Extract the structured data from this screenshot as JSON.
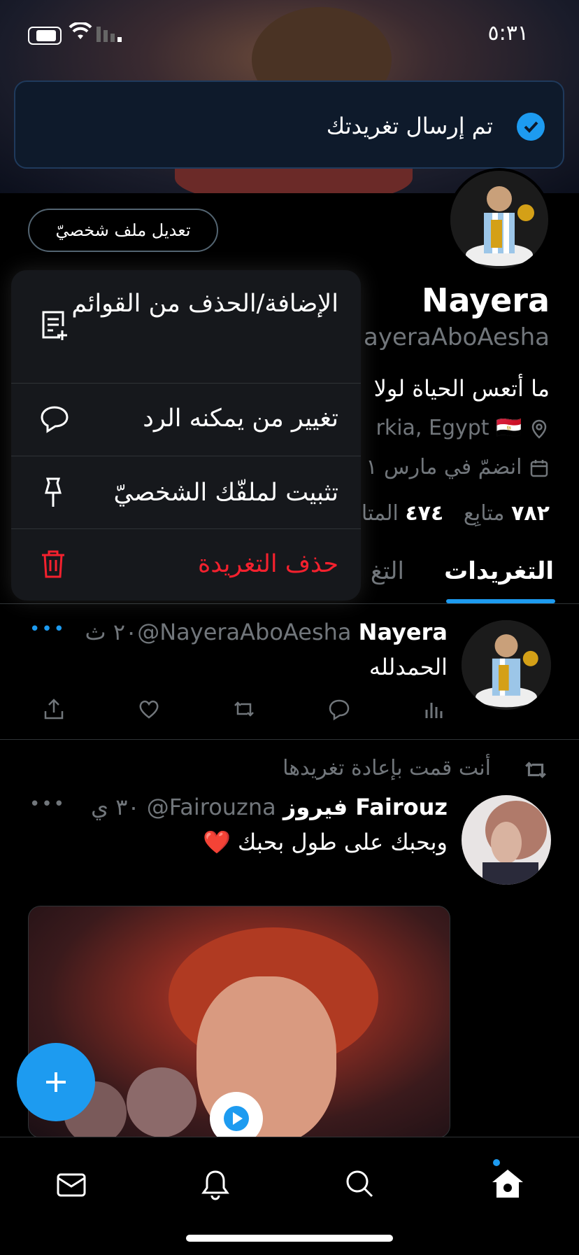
{
  "status_bar": {
    "time": "٥:٣١"
  },
  "toast": {
    "message": "تم إرسال تغريدتك",
    "icon": "check-circle-icon"
  },
  "profile": {
    "edit_button": "تعديل ملف شخصيّ",
    "name": "Nayera",
    "handle": "ayeraAboAesha",
    "bio": "ما أتعس الحياة لولا",
    "location": "rkia, Egypt 🇪🇬",
    "joined": "انضمّ في مارس ١",
    "following_count": "٧٨٢",
    "following_label": "متابِع",
    "followers_count": "٤٧٤",
    "followers_label": "المتا"
  },
  "tabs": [
    {
      "label": "التغريدات",
      "active": true
    },
    {
      "label": "التغ",
      "active": false
    }
  ],
  "menu": {
    "items": [
      {
        "label": "الإضافة/الحذف من القوائم",
        "icon": "list-add-icon"
      },
      {
        "label": "تغيير من يمكنه الرد",
        "icon": "speech-bubble-icon"
      },
      {
        "label": "تثبيت لملفّك الشخصيّ",
        "icon": "pin-icon"
      },
      {
        "label": "حذف التغريدة",
        "icon": "trash-icon",
        "destructive": true
      }
    ]
  },
  "tweets": [
    {
      "name": "Nayera",
      "handle": "@NayeraAboAesha",
      "time": "٢٠ ث",
      "text": "الحمدلله",
      "more": "•••"
    },
    {
      "retweet_label": "أنت قمت بإعادة تغريدها",
      "name": "فيروز Fairouz",
      "handle": "@Fairouzna",
      "time": "٣٠ ي",
      "text": "وبحبك على طول بحبك ❤️",
      "more": "•••"
    }
  ],
  "colors": {
    "accent": "#1d9bf0",
    "danger": "#f4212e",
    "background": "#000000",
    "muted": "#71767b"
  },
  "bottom_nav": [
    {
      "name": "home",
      "icon": "home-icon",
      "active": true
    },
    {
      "name": "search",
      "icon": "search-icon"
    },
    {
      "name": "notifications",
      "icon": "bell-icon"
    },
    {
      "name": "messages",
      "icon": "mail-icon"
    }
  ]
}
